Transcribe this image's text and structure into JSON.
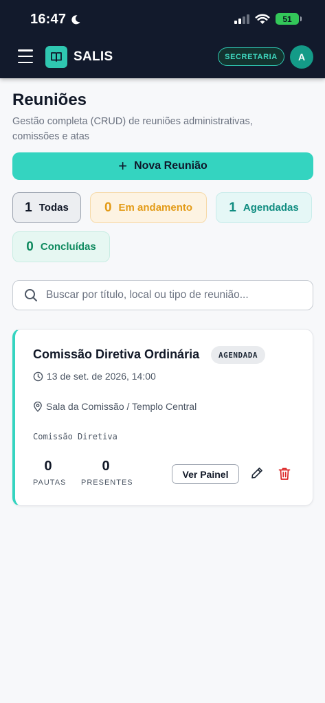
{
  "status_bar": {
    "time": "16:47",
    "battery": "51"
  },
  "app_bar": {
    "title": "SALIS",
    "role": "SECRETARIA",
    "avatar_initial": "A"
  },
  "header": {
    "title": "Reuniões",
    "subtitle": "Gestão completa (CRUD) de reuniões administrativas, comissões e atas"
  },
  "new_button": {
    "label": "Nova Reunião"
  },
  "filters": [
    {
      "count": "1",
      "label": "Todas",
      "color": "#111827"
    },
    {
      "count": "0",
      "label": "Em andamento",
      "color": "#e39b17"
    },
    {
      "count": "1",
      "label": "Agendadas",
      "color": "#0f8c80"
    },
    {
      "count": "0",
      "label": "Concluídas",
      "color": "#0f8a5f"
    }
  ],
  "search": {
    "placeholder": "Buscar por título, local ou tipo de reunião...",
    "value": ""
  },
  "meetings": [
    {
      "title": "Comissão Diretiva Ordinária",
      "status": "AGENDADA",
      "datetime": "13 de set. de 2026, 14:00",
      "location": "Sala da Comissão / Templo Central",
      "committee": "Comissão Diretiva",
      "pautas_count": "0",
      "pautas_label": "PAUTAS",
      "presentes_count": "0",
      "presentes_label": "PRESENTES",
      "panel_button": "Ver Painel"
    }
  ],
  "colors": {
    "accent": "#34d4c0",
    "app_bar_bg": "#121a2c",
    "delete": "#dc2626"
  }
}
